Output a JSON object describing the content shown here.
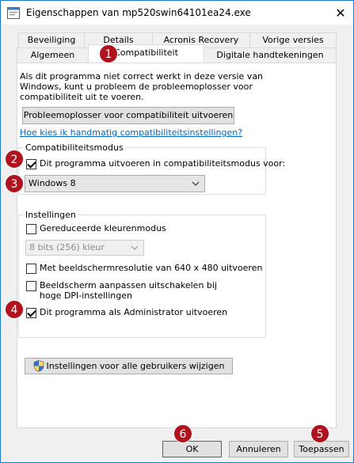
{
  "window": {
    "title": "Eigenschappen van mp520swin64101ea24.exe",
    "close_glyph": "✕"
  },
  "tabs": {
    "row1": [
      "Beveiliging",
      "Details",
      "Acronis Recovery",
      "Vorige versies"
    ],
    "row2": [
      "Algemeen",
      "Compatibiliteit",
      "Digitale handtekeningen"
    ],
    "active": "Compatibiliteit"
  },
  "panel": {
    "intro": "Als dit programma niet correct werkt in deze versie van Windows, kunt u probleem de probleemoplosser voor compatibiliteit uit te voeren.",
    "troubleshoot_button": "Probleemoplosser voor compatibiliteit uitvoeren",
    "manual_link": "Hoe kies ik handmatig compatibiliteitsinstellingen?",
    "compat_mode": {
      "group_label": "Compatibiliteitsmodus",
      "checkbox_label": "Dit programma uitvoeren in compatibiliteitsmodus voor:",
      "checked": true,
      "selected_os": "Windows 8"
    },
    "settings": {
      "group_label": "Instellingen",
      "reduced_color": "Gereduceerde kleurenmodus",
      "color_depth": "8 bits (256) kleur",
      "low_res": "Met beeldschermresolutie van 640 x 480 uitvoeren",
      "dpi_scaling": "Beeldscherm aanpassen uitschakelen bij hoge DPI-instellingen",
      "run_as_admin": "Dit programma als Administrator uitvoeren",
      "run_as_admin_checked": true
    },
    "all_users_button": "Instellingen voor alle gebruikers wijzigen"
  },
  "footer": {
    "ok": "OK",
    "cancel": "Annuleren",
    "apply": "Toepassen"
  },
  "badges": [
    "1",
    "2",
    "3",
    "4",
    "5",
    "6"
  ],
  "colors": {
    "badge": "#b0131d",
    "link": "#0066cc",
    "focus": "#0078d7"
  },
  "icons": {
    "app": "app-file-icon",
    "shield": "uac-shield-icon",
    "dropdown": "chevron-down-icon",
    "close": "close-icon"
  }
}
